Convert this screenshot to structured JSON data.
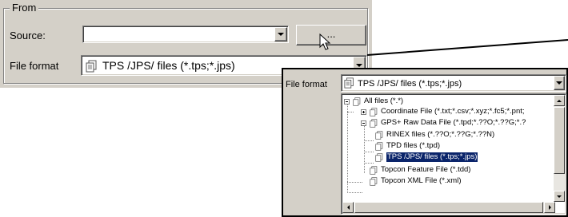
{
  "group": {
    "title": "From"
  },
  "source": {
    "label": "Source:",
    "value": "",
    "browse_label": "..."
  },
  "file_format": {
    "label": "File format",
    "selected": "TPS /JPS/ files (*.tps;*.jps)"
  },
  "zoom": {
    "label": "File format",
    "selected": "TPS /JPS/ files (*.tps;*.jps)",
    "tree": [
      {
        "label": "All files (*.*)"
      },
      {
        "label": "Coordinate File (*.txt;*.csv;*.xyz;*.fc5;*.pnt;"
      },
      {
        "label": "GPS+ Raw Data File (*.tpd;*.??O;*.??G;*.?"
      },
      {
        "label": "RINEX files (*.??O;*.??G;*.??N)"
      },
      {
        "label": "TPD files (*.tpd)"
      },
      {
        "label": "TPS /JPS/ files (*.tps;*.jps)"
      },
      {
        "label": "Topcon Feature File (*.tdd)"
      },
      {
        "label": "Topcon XML File (*.xml)"
      }
    ]
  },
  "icons": {
    "file": "file-icon",
    "collapse": "minus-box-icon",
    "expand": "plus-box-icon",
    "cursor": "mouse-pointer-icon",
    "dropdown": "chevron-down-icon"
  },
  "colors": {
    "face": "#d4d0c8",
    "selection": "#0a246a",
    "field": "#ffffff"
  }
}
